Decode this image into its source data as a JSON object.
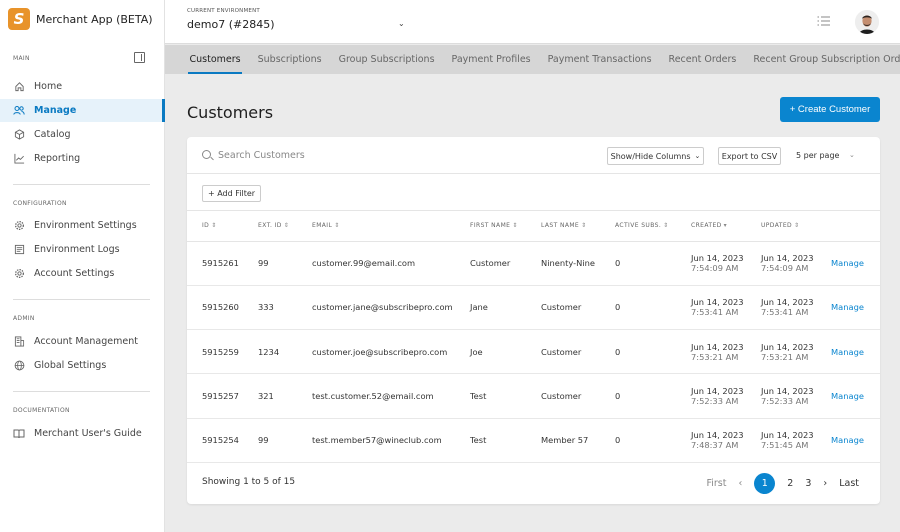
{
  "app": {
    "name": "Merchant App (BETA)",
    "logo_letter": "S",
    "brand_color": "#e8932a",
    "accent_color": "#0a85cf"
  },
  "sidebar": {
    "sections": [
      {
        "label": "MAIN",
        "items": [
          {
            "label": "Home",
            "icon": "home-icon",
            "active": false
          },
          {
            "label": "Manage",
            "icon": "users-icon",
            "active": true
          },
          {
            "label": "Catalog",
            "icon": "box-icon",
            "active": false
          },
          {
            "label": "Reporting",
            "icon": "chart-line-icon",
            "active": false
          }
        ]
      },
      {
        "label": "CONFIGURATION",
        "items": [
          {
            "label": "Environment Settings",
            "icon": "gear-icon",
            "active": false
          },
          {
            "label": "Environment Logs",
            "icon": "logs-icon",
            "active": false
          },
          {
            "label": "Account Settings",
            "icon": "gear-icon",
            "active": false
          }
        ]
      },
      {
        "label": "ADMIN",
        "items": [
          {
            "label": "Account Management",
            "icon": "building-icon",
            "active": false
          },
          {
            "label": "Global Settings",
            "icon": "globe-icon",
            "active": false
          }
        ]
      },
      {
        "label": "DOCUMENTATION",
        "items": [
          {
            "label": "Merchant User's Guide",
            "icon": "book-icon",
            "active": false
          }
        ]
      }
    ]
  },
  "topbar": {
    "env_label": "CURRENT ENVIRONMENT",
    "env_value": "demo7 (#2845)"
  },
  "tabs": [
    {
      "label": "Customers",
      "active": true
    },
    {
      "label": "Subscriptions",
      "active": false
    },
    {
      "label": "Group Subscriptions",
      "active": false
    },
    {
      "label": "Payment Profiles",
      "active": false
    },
    {
      "label": "Payment Transactions",
      "active": false
    },
    {
      "label": "Recent Orders",
      "active": false
    },
    {
      "label": "Recent Group Subscription Orders",
      "active": false
    }
  ],
  "page": {
    "title": "Customers",
    "create_button": "+ Create Customer"
  },
  "toolbar": {
    "search_placeholder": "Search Customers",
    "show_hide_columns": "Show/Hide Columns",
    "export_csv": "Export to CSV",
    "per_page": "5 per page",
    "add_filter": "+ Add Filter"
  },
  "table": {
    "columns": [
      "ID",
      "EXT. ID",
      "EMAIL",
      "FIRST NAME",
      "LAST NAME",
      "ACTIVE SUBS.",
      "CREATED",
      "UPDATED"
    ],
    "action_label": "Manage",
    "rows": [
      {
        "id": "5915261",
        "ext_id": "99",
        "email": "customer.99@email.com",
        "first": "Customer",
        "last": "Ninenty-Nine",
        "active": "0",
        "created_date": "Jun 14, 2023",
        "created_time": "7:54:09 AM",
        "updated_date": "Jun 14, 2023",
        "updated_time": "7:54:09 AM"
      },
      {
        "id": "5915260",
        "ext_id": "333",
        "email": "customer.jane@subscribepro.com",
        "first": "Jane",
        "last": "Customer",
        "active": "0",
        "created_date": "Jun 14, 2023",
        "created_time": "7:53:41 AM",
        "updated_date": "Jun 14, 2023",
        "updated_time": "7:53:41 AM"
      },
      {
        "id": "5915259",
        "ext_id": "1234",
        "email": "customer.joe@subscribepro.com",
        "first": "Joe",
        "last": "Customer",
        "active": "0",
        "created_date": "Jun 14, 2023",
        "created_time": "7:53:21 AM",
        "updated_date": "Jun 14, 2023",
        "updated_time": "7:53:21 AM"
      },
      {
        "id": "5915257",
        "ext_id": "321",
        "email": "test.customer.52@email.com",
        "first": "Test",
        "last": "Customer",
        "active": "0",
        "created_date": "Jun 14, 2023",
        "created_time": "7:52:33 AM",
        "updated_date": "Jun 14, 2023",
        "updated_time": "7:52:33 AM"
      },
      {
        "id": "5915254",
        "ext_id": "99",
        "email": "test.member57@wineclub.com",
        "first": "Test",
        "last": "Member 57",
        "active": "0",
        "created_date": "Jun 14, 2023",
        "created_time": "7:48:37 AM",
        "updated_date": "Jun 14, 2023",
        "updated_time": "7:51:45 AM"
      }
    ]
  },
  "pagination": {
    "summary": "Showing 1 to 5 of 15",
    "first": "First",
    "last": "Last",
    "prev": "‹",
    "next": "›",
    "pages": [
      "1",
      "2",
      "3"
    ],
    "current": "1"
  }
}
